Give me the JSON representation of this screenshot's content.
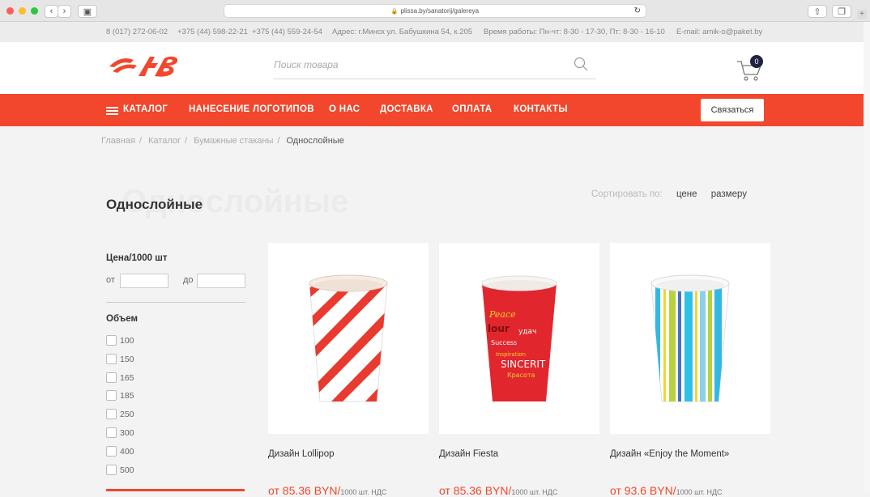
{
  "browser": {
    "url": "plissa.by/sanatorij/galereya"
  },
  "topbar": {
    "phone1": "8 (017) 272-06-02",
    "phone2": "+375 (44) 598-22-21",
    "phone3": "+375 (44) 559-24-54",
    "address": "Адрес: г.Минск ул. Бабушкина 54, к.205",
    "hours": "Время работы: Пн-чт: 8-30 - 17-30, Пт: 8-30 - 16-10",
    "email": "E-mail: amik-o@paket.by"
  },
  "header": {
    "search_placeholder": "Поиск товара",
    "cart_count": "0"
  },
  "nav": {
    "items": [
      "КАТАЛОГ",
      "НАНЕСЕНИЕ ЛОГОТИПОВ",
      "О НАС",
      "ДОСТАВКА",
      "ОПЛАТА",
      "КОНТАКТЫ"
    ],
    "contact_button": "Связаться"
  },
  "breadcrumbs": [
    "Главная",
    "Каталог",
    "Бумажные стаканы",
    "Однослойные"
  ],
  "page": {
    "title": "Однослойные",
    "sort_label": "Сортировать по:",
    "sort_options": [
      "цене",
      "размеру"
    ]
  },
  "filters": {
    "price_title": "Цена/1000 шт",
    "from_label": "от",
    "to_label": "до",
    "volume_title": "Объем",
    "volumes": [
      "100",
      "150",
      "165",
      "185",
      "250",
      "300",
      "400",
      "500"
    ]
  },
  "products": [
    {
      "name": "Дизайн Lollipop",
      "price": "от 85.36 BYN/",
      "unit": "1000 шт. НДС"
    },
    {
      "name": "Дизайн Fiesta",
      "price": "от 85.36 BYN/",
      "unit": "1000 шт. НДС"
    },
    {
      "name": "Дизайн «Enjoy the Moment»",
      "price": "от 93.6 BYN/",
      "unit": "1000 шт. НДС"
    }
  ],
  "colors": {
    "accent": "#f2472c",
    "cart_badge": "#1f2240"
  }
}
